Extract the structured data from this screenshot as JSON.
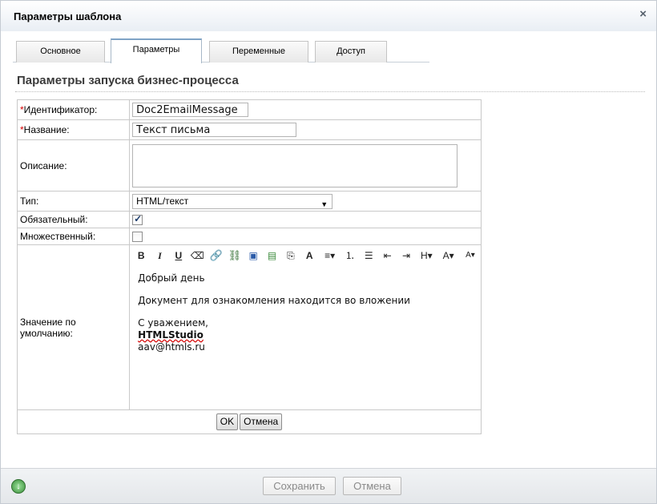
{
  "dialog": {
    "title": "Параметры шаблона",
    "close_label": "×"
  },
  "tabs": [
    {
      "label": "Основное"
    },
    {
      "label": "Параметры"
    },
    {
      "label": "Переменные"
    },
    {
      "label": "Доступ"
    }
  ],
  "section_title": "Параметры запуска бизнес-процесса",
  "form": {
    "required_mark": "*",
    "identifier": {
      "label": "Идентификатор:",
      "value": "Doc2EmailMessage"
    },
    "name": {
      "label": "Название:",
      "value": "Текст письма"
    },
    "description": {
      "label": "Описание:",
      "value": ""
    },
    "type": {
      "label": "Тип:",
      "value": "HTML/текст"
    },
    "required": {
      "label": "Обязательный:",
      "checked": true
    },
    "multiple": {
      "label": "Множественный:",
      "checked": false
    },
    "default_value": {
      "label": "Значение по умолчанию:"
    }
  },
  "editor": {
    "toolbar": [
      {
        "icon": "bold-icon",
        "glyph": "B"
      },
      {
        "icon": "italic-icon",
        "glyph": "I"
      },
      {
        "icon": "underline-icon",
        "glyph": "U"
      },
      {
        "icon": "eraser-icon",
        "glyph": "⌫"
      },
      {
        "icon": "link-icon",
        "glyph": "🔗"
      },
      {
        "icon": "unlink-icon",
        "glyph": "⛓"
      },
      {
        "icon": "image-icon",
        "glyph": "▣"
      },
      {
        "icon": "video-icon",
        "glyph": "▤"
      },
      {
        "icon": "paste-icon",
        "glyph": "⎘"
      },
      {
        "icon": "font-icon",
        "glyph": "A"
      },
      {
        "icon": "align-icon",
        "glyph": "≡▾"
      },
      {
        "icon": "ordered-list-icon",
        "glyph": "⒈"
      },
      {
        "icon": "unordered-list-icon",
        "glyph": "☰"
      },
      {
        "icon": "outdent-icon",
        "glyph": "⇤"
      },
      {
        "icon": "indent-icon",
        "glyph": "⇥"
      },
      {
        "icon": "heading-icon",
        "glyph": "H▾"
      },
      {
        "icon": "font-size-icon",
        "glyph": "A▾"
      },
      {
        "icon": "font-color-icon",
        "glyph": "A▾"
      }
    ],
    "content": {
      "greeting": "Добрый день",
      "body": "Документ для ознакомления находится во вложении",
      "regards": "С уважением,",
      "company": "HTMLStudio",
      "email": "aav@htmls.ru"
    }
  },
  "buttons": {
    "ok": "OK",
    "cancel_inner": "Отмена",
    "save": "Сохранить",
    "cancel": "Отмена"
  }
}
